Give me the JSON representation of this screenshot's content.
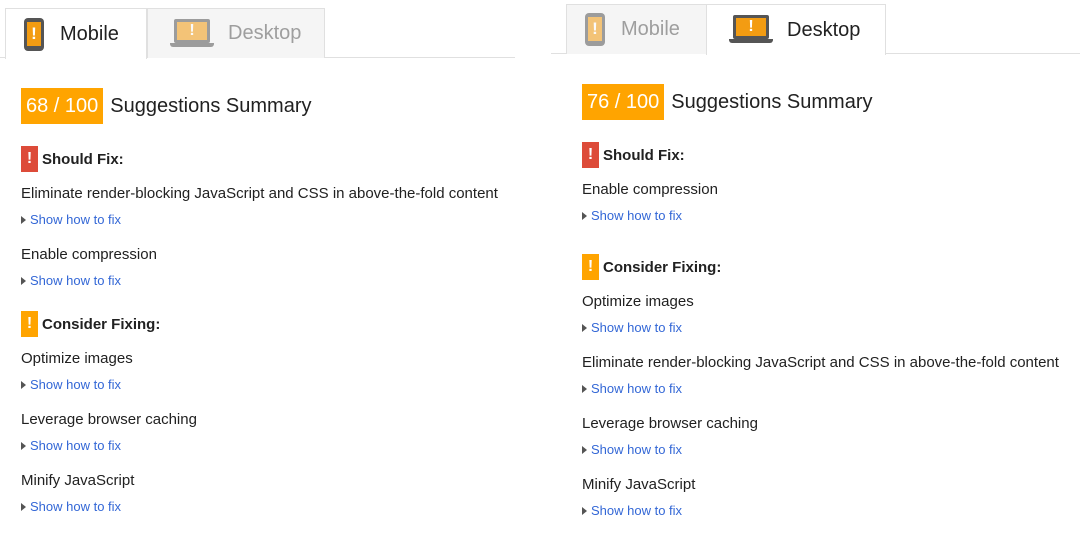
{
  "left": {
    "tabs": {
      "mobile": "Mobile",
      "desktop": "Desktop",
      "active": "mobile"
    },
    "score": "68 / 100",
    "summary_title": "Suggestions Summary",
    "sections": [
      {
        "severity": "red",
        "badge": "!",
        "title": "Should Fix:",
        "items": [
          {
            "title": "Eliminate render-blocking JavaScript and CSS in above-the-fold content",
            "link": "Show how to fix"
          },
          {
            "title": "Enable compression",
            "link": "Show how to fix"
          }
        ]
      },
      {
        "severity": "orange",
        "badge": "!",
        "title": "Consider Fixing:",
        "items": [
          {
            "title": "Optimize images",
            "link": "Show how to fix"
          },
          {
            "title": "Leverage browser caching",
            "link": "Show how to fix"
          },
          {
            "title": "Minify JavaScript",
            "link": "Show how to fix"
          }
        ]
      }
    ]
  },
  "right": {
    "tabs": {
      "mobile": "Mobile",
      "desktop": "Desktop",
      "active": "desktop"
    },
    "score": "76 / 100",
    "summary_title": "Suggestions Summary",
    "sections": [
      {
        "severity": "red",
        "badge": "!",
        "title": "Should Fix:",
        "items": [
          {
            "title": "Enable compression",
            "link": "Show how to fix"
          }
        ]
      },
      {
        "severity": "orange",
        "badge": "!",
        "title": "Consider Fixing:",
        "items": [
          {
            "title": "Optimize images",
            "link": "Show how to fix"
          },
          {
            "title": "Eliminate render-blocking JavaScript and CSS in above-the-fold content",
            "link": "Show how to fix"
          },
          {
            "title": "Leverage browser caching",
            "link": "Show how to fix"
          },
          {
            "title": "Minify JavaScript",
            "link": "Show how to fix"
          }
        ]
      }
    ]
  },
  "colors": {
    "score_bg": "#ffa400",
    "should_fix": "#dd4b39",
    "consider_fixing": "#ffa400",
    "link": "#3367d6"
  },
  "icons": {
    "mobile": "phone-warning-icon",
    "desktop": "laptop-warning-icon",
    "badge": "exclamation-icon",
    "link": "triangle-right-icon"
  }
}
